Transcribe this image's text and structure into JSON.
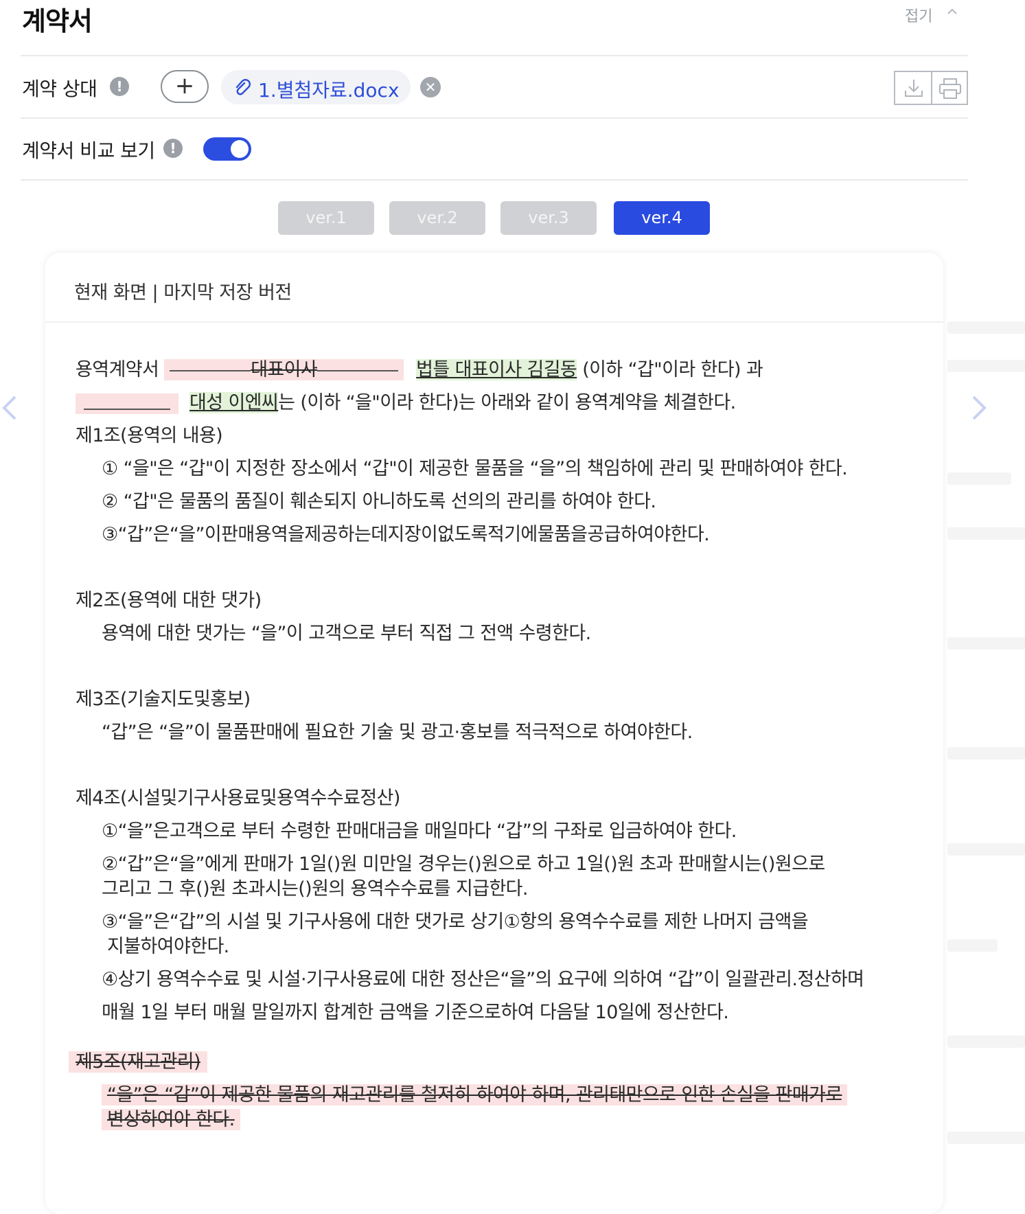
{
  "header": {
    "title": "계약서",
    "fold_label": "접기"
  },
  "party": {
    "label": "계약 상대",
    "info_icon": "!",
    "add_icon": "+",
    "file_name": "1.별첨자료.docx",
    "remove_icon": "✕"
  },
  "compare": {
    "label": "계약서 비교 보기",
    "info_icon": "!",
    "toggle_on": true
  },
  "versions": [
    {
      "label": "ver.1",
      "active": false
    },
    {
      "label": "ver.2",
      "active": false
    },
    {
      "label": "ver.3",
      "active": false
    },
    {
      "label": "ver.4",
      "active": true
    }
  ],
  "card": {
    "header": "현재 화면 | 마지막 저장 버전",
    "intro": {
      "l1_prefix": "용역계약서",
      "l1_deleted": "대표이사",
      "l1_inserted": "법틀 대표이사 김길동",
      "l1_suffix": " (이하 “갑\"이라 한다) 과",
      "l2_inserted": "대성 이엔씨",
      "l2_suffix": "는 (이하 “을\"이라 한다)는 아래와 같이 용역계약을 체결한다."
    },
    "art1": {
      "title": "제1조(용역의 내용)",
      "items": [
        "① “을\"은 “갑\"이 지정한 장소에서 “갑\"이 제공한 물품을 “을”의 책임하에 관리 및 판매하여야 한다.",
        "② “갑\"은 물품의 품질이 훼손되지 아니하도록 선의의 관리를 하여야 한다.",
        "③“갑”은“을”이판매용역을제공하는데지장이없도록적기에물품을공급하여야한다."
      ]
    },
    "art2": {
      "title": "제2조(용역에 대한 댓가)",
      "body": "용역에 대한 댓가는 “을”이 고객으로 부터 직접 그 전액 수령한다."
    },
    "art3": {
      "title": "제3조(기술지도및홍보)",
      "body": "“갑”은 “을”이 물품판매에 필요한 기술 및 광고·홍보를 적극적으로 하여야한다."
    },
    "art4": {
      "title": "제4조(시설및기구사용료및용역수수료정산)",
      "i1": "①“을”은고객으로 부터 수령한 판매대금을 매일마다 “갑”의 구좌로 입금하여야 한다.",
      "i2a": "②“갑”은“을”에게 판매가 1일()원 미만일 경우는()원으로 하고 1일()원 초과 판매할시는()원으로",
      "i2b": "그리고 그 후()원 초과시는()원의 용역수수료를 지급한다.",
      "i3a": "③“을”은“갑”의 시설 및 기구사용에 대한 댓가로 상기①항의 용역수수료를 제한 나머지 금액을",
      "i3b": "지불하여야한다.",
      "i4a": "④상기 용역수수료 및 시설·기구사용료에 대한 정산은“을”의 요구에 의하여 “갑”이 일괄관리.정산하며",
      "i4b": "매월 1일 부터 매월 말일까지 합계한 금액을 기준으로하여 다음달 10일에 정산한다."
    },
    "art5": {
      "title": "제5조(재고관리)",
      "l1": "“을”은 “갑”이 제공한 물품의 재고관리를 철저히 하여야 하며, 관리태만으로 인한 손실을 판매가로",
      "l2": "변상하여야 한다."
    }
  },
  "colors": {
    "accent": "#2a4be0",
    "deleted_bg": "#fbe1e1",
    "inserted_bg": "#e2f3d9"
  }
}
